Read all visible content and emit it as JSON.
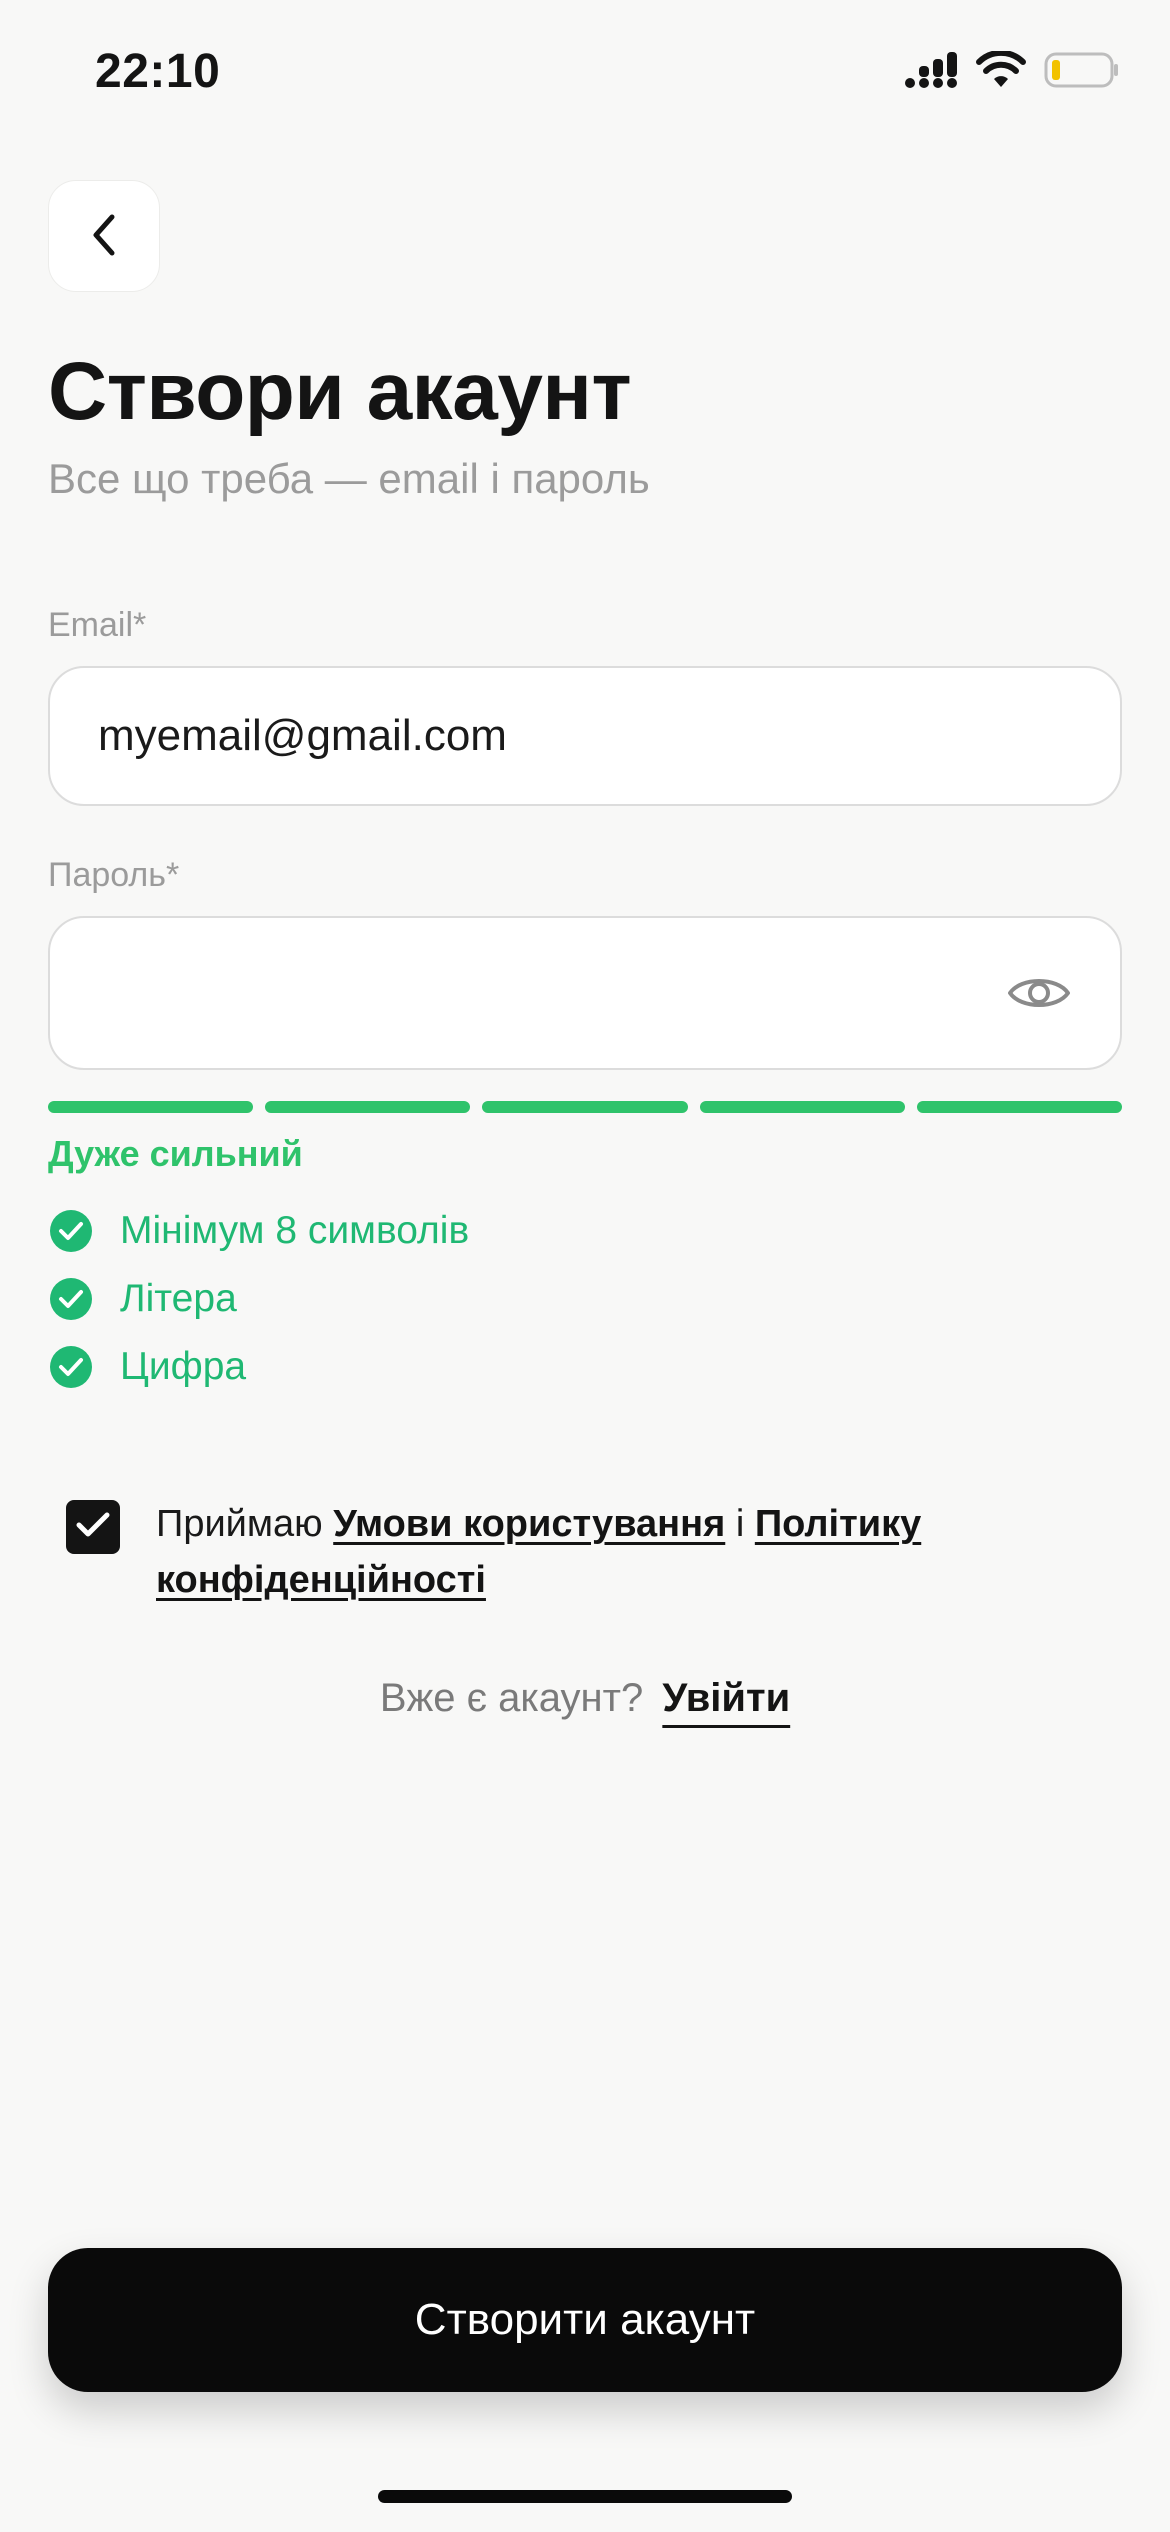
{
  "status_bar": {
    "time": "22:10"
  },
  "header": {
    "title": "Створи акаунт",
    "subtitle": "Все що треба — email і пароль"
  },
  "form": {
    "email_label": "Email*",
    "email_value": "myemail@gmail.com",
    "password_label": "Пароль*",
    "password_value": ""
  },
  "strength": {
    "label": "Дуже сильний",
    "color": "#2fc36b",
    "segments_total": 5,
    "segments_filled": 5
  },
  "requirements": [
    {
      "label": "Мінімум 8 символів",
      "met": true
    },
    {
      "label": "Літера",
      "met": true
    },
    {
      "label": "Цифра",
      "met": true
    }
  ],
  "requirement_color": "#1fb873",
  "terms": {
    "checked": true,
    "prefix": "Приймаю ",
    "terms_link": "Умови користування",
    "joiner": " і ",
    "privacy_link": "Політику конфіденційності"
  },
  "login": {
    "prompt": "Вже є акаунт?",
    "link": "Увійти"
  },
  "primary_button": {
    "label": "Створити акаунт"
  }
}
